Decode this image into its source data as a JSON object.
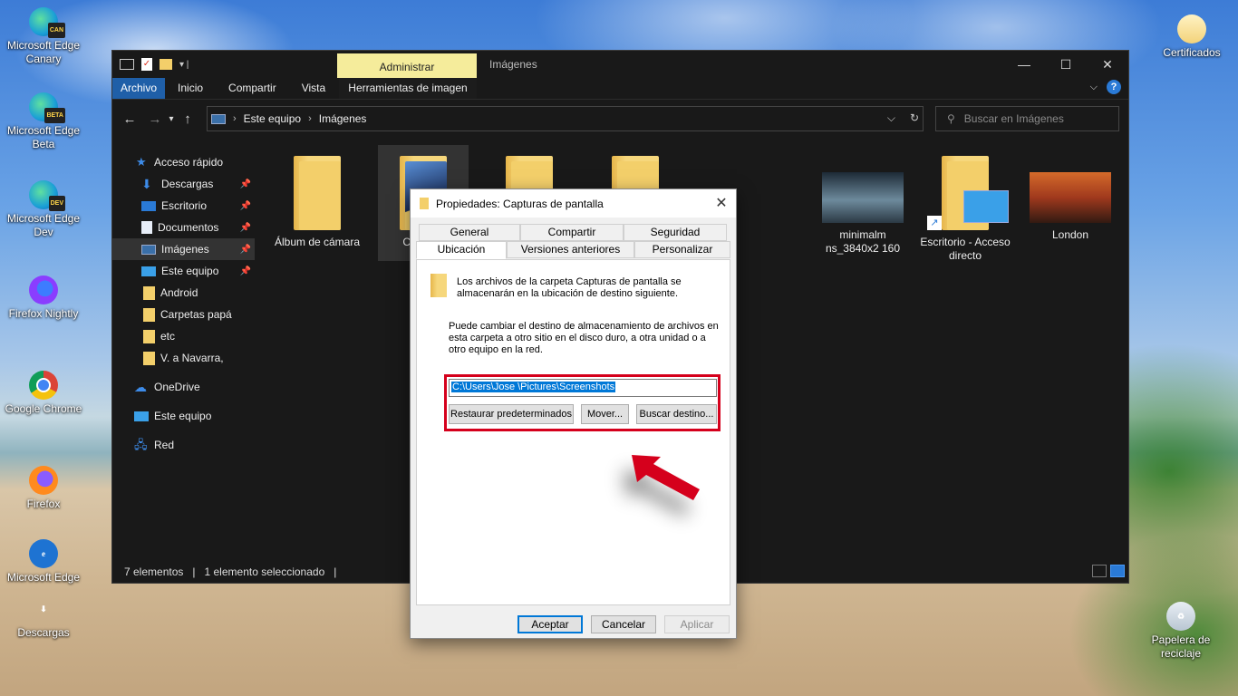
{
  "desktop": {
    "icons_left": [
      {
        "name": "edge-canary",
        "label": "Microsoft Edge Canary",
        "badge": "CAN"
      },
      {
        "name": "edge-beta",
        "label": "Microsoft Edge Beta",
        "badge": "BETA"
      },
      {
        "name": "edge-dev",
        "label": "Microsoft Edge Dev",
        "badge": "DEV"
      },
      {
        "name": "firefox-nightly",
        "label": "Firefox Nightly"
      },
      {
        "name": "google-chrome",
        "label": "Google Chrome"
      },
      {
        "name": "firefox",
        "label": "Firefox"
      },
      {
        "name": "microsoft-edge",
        "label": "Microsoft Edge"
      },
      {
        "name": "descargas",
        "label": "Descargas"
      }
    ],
    "icons_right": [
      {
        "name": "certificados",
        "label": "Certificados"
      },
      {
        "name": "papelera",
        "label": "Papelera de reciclaje"
      }
    ]
  },
  "explorer": {
    "context_tab": "Administrar",
    "title": "Imágenes",
    "window_controls": {
      "minimize": "—",
      "maximize": "☐",
      "close": "✕"
    },
    "ribbon_tabs": [
      "Archivo",
      "Inicio",
      "Compartir",
      "Vista"
    ],
    "context_ribbon_tab": "Herramientas de imagen",
    "breadcrumb": [
      "Este equipo",
      "Imágenes"
    ],
    "search_placeholder": "Buscar en Imágenes",
    "sidebar": [
      {
        "label": "Acceso rápido",
        "icon": "star-icon",
        "pinned": false
      },
      {
        "label": "Descargas",
        "icon": "download-icon",
        "pinned": true
      },
      {
        "label": "Escritorio",
        "icon": "desktop-icon",
        "pinned": true
      },
      {
        "label": "Documentos",
        "icon": "documents-icon",
        "pinned": true
      },
      {
        "label": "Imágenes",
        "icon": "pictures-icon",
        "pinned": true,
        "selected": true
      },
      {
        "label": "Este equipo",
        "icon": "computer-icon",
        "pinned": true
      },
      {
        "label": "Android",
        "icon": "folder-icon",
        "pinned": false
      },
      {
        "label": "Carpetas papá",
        "icon": "folder-icon",
        "pinned": false
      },
      {
        "label": "etc",
        "icon": "folder-icon",
        "pinned": false
      },
      {
        "label": "V. a Navarra,",
        "icon": "folder-icon",
        "pinned": false
      },
      {
        "label": "OneDrive",
        "icon": "cloud-icon",
        "pinned": false
      },
      {
        "label": "Este equipo",
        "icon": "computer-icon",
        "pinned": false
      },
      {
        "label": "Red",
        "icon": "network-icon",
        "pinned": false
      }
    ],
    "files": [
      {
        "label": "Álbum de cámara",
        "type": "folder"
      },
      {
        "label": "Ca... p...",
        "type": "folder",
        "selected": true
      },
      {
        "label": "",
        "type": "folder"
      },
      {
        "label": "",
        "type": "folder"
      },
      {
        "label": "minimalm ns_3840x2 160",
        "type": "image"
      },
      {
        "label": "Escritorio - Acceso directo",
        "type": "shortcut"
      },
      {
        "label": "London",
        "type": "image"
      }
    ],
    "status": {
      "count": "7 elementos",
      "selected": "1 elemento seleccionado"
    }
  },
  "dialog": {
    "title": "Propiedades: Capturas de pantalla",
    "tabs_row1": [
      "General",
      "Compartir",
      "Seguridad"
    ],
    "tabs_row2": [
      "Ubicación",
      "Versiones anteriores",
      "Personalizar"
    ],
    "active_tab": "Ubicación",
    "info1": "Los archivos de la carpeta Capturas de pantalla se almacenarán en la ubicación de destino siguiente.",
    "info2": "Puede cambiar el destino de almacenamiento de archivos en esta carpeta a otro sitio en el disco duro, a otra unidad o a otro equipo en la red.",
    "path_value": "C:\\Users\\Jose   \\Pictures\\Screenshots",
    "btn_restore": "Restaurar predeterminados",
    "btn_move": "Mover...",
    "btn_find": "Buscar destino...",
    "btn_ok": "Aceptar",
    "btn_cancel": "Cancelar",
    "btn_apply": "Aplicar"
  },
  "colors": {
    "highlight": "#d5001c",
    "accent": "#0078d7",
    "context_tab": "#f5ec9b"
  }
}
